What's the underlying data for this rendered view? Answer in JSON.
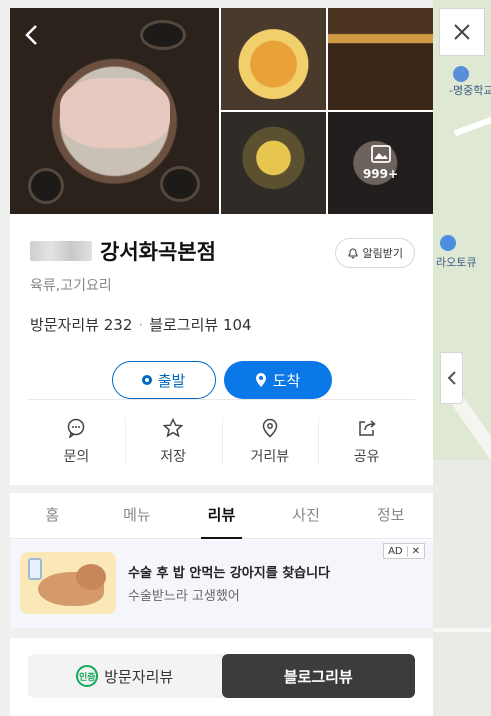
{
  "map": {
    "labels": [
      {
        "text": "-명중학교"
      },
      {
        "text": "라오토큐"
      }
    ]
  },
  "window": {
    "close_icon": "close-icon",
    "collapse_icon": "chevron-left-icon"
  },
  "gallery": {
    "back_icon": "chevron-left-icon",
    "more_count": "999+"
  },
  "place": {
    "name": "강서화곡본점",
    "category": "육류,고기요리",
    "visitor_reviews_label": "방문자리뷰 232",
    "blog_reviews_label": "블로그리뷰 104",
    "separator": "·",
    "alarm_label": "알림받기"
  },
  "route": {
    "start_label": "출발",
    "arrive_label": "도착"
  },
  "actions": [
    {
      "label": "문의",
      "icon": "chat-icon"
    },
    {
      "label": "저장",
      "icon": "star-icon"
    },
    {
      "label": "거리뷰",
      "icon": "location-pin-icon"
    },
    {
      "label": "공유",
      "icon": "share-icon"
    }
  ],
  "tabs": [
    {
      "label": "홈",
      "active": false
    },
    {
      "label": "메뉴",
      "active": false
    },
    {
      "label": "리뷰",
      "active": true
    },
    {
      "label": "사진",
      "active": false
    },
    {
      "label": "정보",
      "active": false
    }
  ],
  "ad": {
    "title": "수술 후 밥 안먹는 강아지를 찾습니다",
    "subtitle": "수술받느라 고생했어",
    "badge_label": "AD",
    "badge_close": "✕"
  },
  "review_switch": {
    "visitor_label": "방문자리뷰",
    "blog_label": "블로그리뷰",
    "cert_badge": "인증",
    "active": "blog"
  },
  "colors": {
    "primary": "#0068c3",
    "arrive_bg": "#0a78e6",
    "active_switch": "#3c3c3c",
    "cert_green": "#11a95a"
  }
}
